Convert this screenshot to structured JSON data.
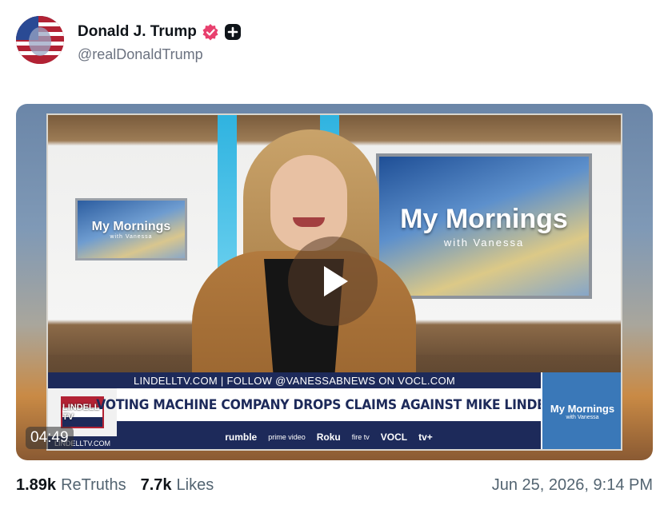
{
  "author": {
    "display_name": "Donald J. Trump",
    "handle": "@realDonaldTrump",
    "verified_icon": "verified-badge-icon",
    "plus_icon": "plus-icon"
  },
  "video": {
    "duration": "04:49",
    "show_name": "My Mornings",
    "show_sub": "with Vanessa",
    "ticker_top": "LINDELLTV.COM | FOLLOW @VANESSABNEWS ON VOCL.COM",
    "headline": "VOTING MACHINE COMPANY DROPS CLAIMS AGAINST MIKE LINDELL",
    "logo_text": "LINDELL TV",
    "logo_url": "LINDELLTV.COM",
    "platforms": [
      "rumble",
      "prime video",
      "Roku",
      "fire tv",
      "VOCL",
      "tv+"
    ],
    "colors": {
      "navy": "#1d2a5a",
      "show_blue": "#3a78b8",
      "accent_cyan": "#2fb3e0"
    }
  },
  "stats": {
    "retruths_count": "1.89k",
    "retruths_label": "ReTruths",
    "likes_count": "7.7k",
    "likes_label": "Likes",
    "timestamp": "Jun 25, 2026, 9:14 PM"
  }
}
